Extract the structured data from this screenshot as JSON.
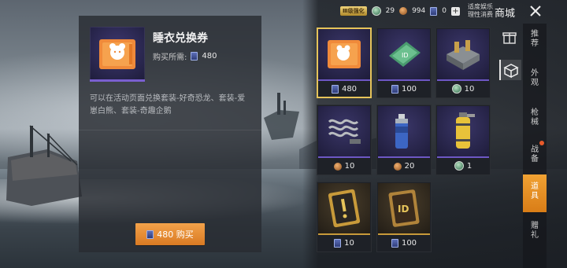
{
  "detail": {
    "title": "睡衣兑换券",
    "price_label": "购买所需:",
    "price_value": "480",
    "description": "可以在活动页面兑换套装-好奇恐龙、套装-爱崽白熊、套装-奇趣企鹅",
    "buy_label": "480 购买"
  },
  "topbar": {
    "badge": "Ⅲ级强化",
    "green_value": "29",
    "bronze_value": "994",
    "voucher_value": "0",
    "plus": "+",
    "notice_line1": "适度娱乐",
    "notice_line2": "理性消费",
    "shop_title": "商城"
  },
  "tabs": [
    {
      "label": "推荐",
      "active": false
    },
    {
      "label": "外观",
      "active": false
    },
    {
      "label": "枪械",
      "active": false
    },
    {
      "label": "战备",
      "active": false
    },
    {
      "label": "道具",
      "active": true
    },
    {
      "label": "赠礼",
      "active": false
    }
  ],
  "items": [
    {
      "icon": "pajama-voucher-icon",
      "currency": "voucher",
      "price": "480",
      "selected": true,
      "rarity": "purple"
    },
    {
      "icon": "rename-card-icon",
      "currency": "voucher",
      "price": "100",
      "selected": false,
      "rarity": "purple"
    },
    {
      "icon": "supply-crate-icon",
      "currency": "green",
      "price": "10",
      "selected": false,
      "rarity": "purple"
    },
    {
      "icon": "spring-part-icon",
      "currency": "bronze",
      "price": "10",
      "selected": false,
      "rarity": "purple"
    },
    {
      "icon": "spray-can-icon",
      "currency": "bronze",
      "price": "20",
      "selected": false,
      "rarity": "purple"
    },
    {
      "icon": "smoke-grenade-icon",
      "currency": "green",
      "price": "1",
      "selected": false,
      "rarity": "purple"
    },
    {
      "icon": "alert-card-icon",
      "currency": "voucher",
      "price": "10",
      "selected": false,
      "rarity": "gold"
    },
    {
      "icon": "id-card-icon",
      "currency": "voucher",
      "price": "100",
      "selected": false,
      "rarity": "gold"
    }
  ],
  "colors": {
    "accent_orange": "#e58a2a",
    "selected_border": "#e6c45a",
    "rarity_purple": "#6d57c4",
    "rarity_gold": "#c89a3a"
  }
}
